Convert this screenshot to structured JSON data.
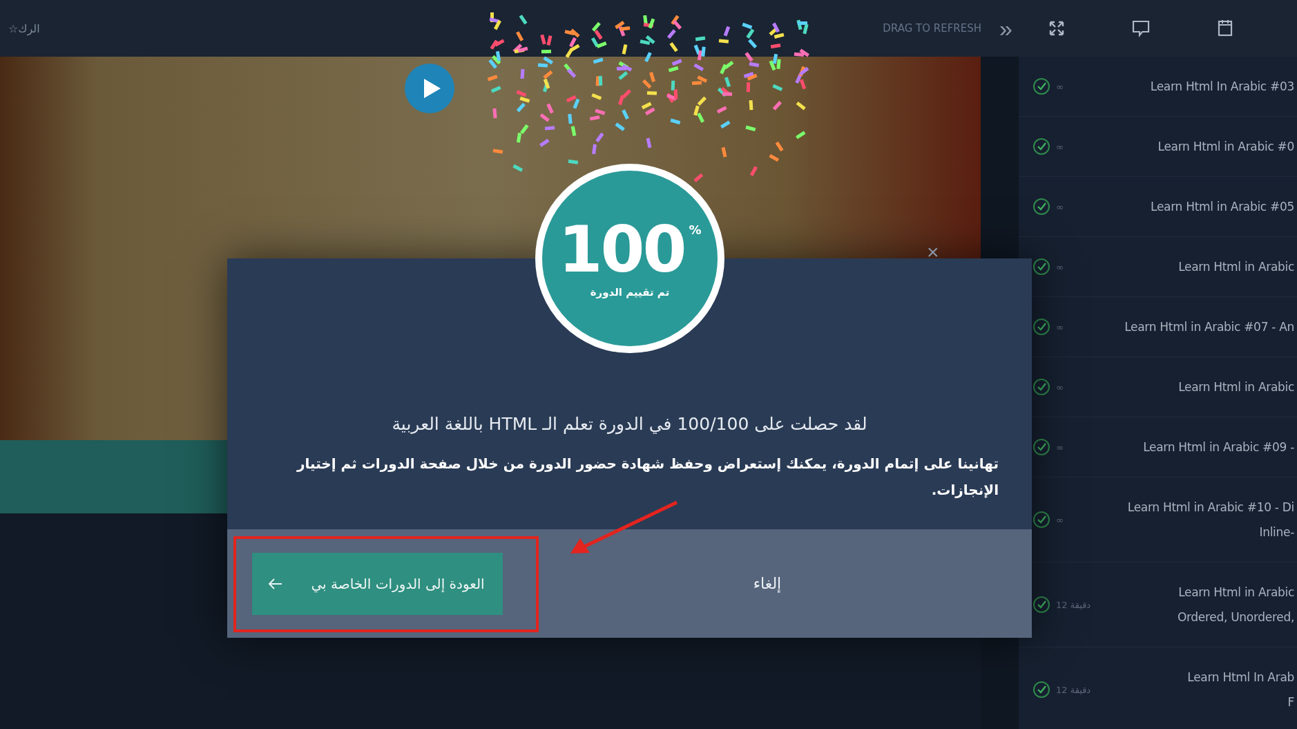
{
  "top_bar": {
    "left_label": "☆الرك",
    "refresh_hint": "DRAG TO REFRESH",
    "chevron": "»"
  },
  "lessons": [
    {
      "lines": [
        "Learn Html In Arabic #03"
      ],
      "duration": "∞",
      "completed": true
    },
    {
      "lines": [
        "Learn Html in Arabic #0"
      ],
      "duration": "∞",
      "completed": true
    },
    {
      "lines": [
        "Learn Html in Arabic #05"
      ],
      "duration": "∞",
      "completed": true
    },
    {
      "lines": [
        "Learn Html in Arabic"
      ],
      "duration": "∞",
      "completed": true
    },
    {
      "lines": [
        "Learn Html in Arabic #07 - An"
      ],
      "duration": "∞",
      "completed": true
    },
    {
      "lines": [
        "Learn Html in Arabic"
      ],
      "duration": "∞",
      "completed": true
    },
    {
      "lines": [
        "Learn Html in Arabic #09 -"
      ],
      "duration": "∞",
      "completed": true
    },
    {
      "lines": [
        "Learn Html in Arabic #10 - Di",
        "Inline-"
      ],
      "duration": "∞",
      "completed": true
    },
    {
      "lines": [
        "Learn Html in Arabic",
        "Ordered, Unordered,"
      ],
      "duration": "12 دقيقة",
      "completed": true
    },
    {
      "lines": [
        "Learn Html In Arab",
        "F"
      ],
      "duration": "12 دقيقة",
      "completed": true
    }
  ],
  "dialog": {
    "score": "100",
    "percent": "%",
    "score_caption": "تم تقييم الدورة",
    "close": "×",
    "message": "لقد حصلت على 100/100 في الدورة تعلم الـ HTML باللغة العربية",
    "note": "تهانينا على إتمام الدورة، يمكنك إستعراض وحفظ شهادة حضور الدورة من خلال صفحة الدورات ثم إختيار الإنجازات.",
    "primary_button": "العودة إلى الدورات الخاصة بي",
    "cancel_button": "إلغاء"
  }
}
